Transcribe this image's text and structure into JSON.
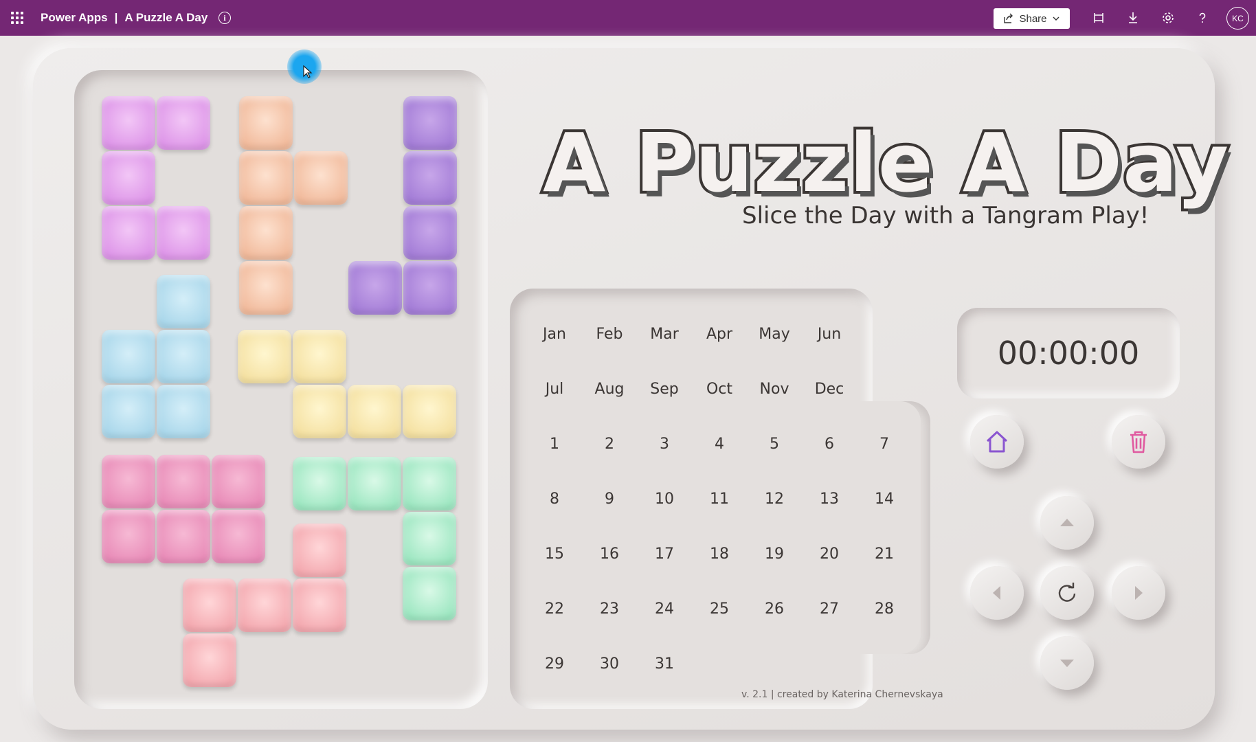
{
  "topbar": {
    "app_name": "Power Apps",
    "separator": "|",
    "app_title": "A Puzzle A Day",
    "share_label": "Share",
    "avatar_initials": "KC",
    "icons": [
      "waffle-icon",
      "info-icon",
      "share-icon",
      "chevron-down-icon",
      "fit-to-window-icon",
      "download-icon",
      "settings-icon",
      "help-icon"
    ],
    "bar_color": "#742774"
  },
  "game": {
    "title": "A Puzzle A Day",
    "subtitle": "Slice the Day with a Tangram Play!",
    "timer": "00:00:00",
    "version_text": "v. 2.1 | created by Katerina Chernevskaya",
    "calendar": {
      "months": [
        "Jan",
        "Feb",
        "Mar",
        "Apr",
        "May",
        "Jun",
        "Jul",
        "Aug",
        "Sep",
        "Oct",
        "Nov",
        "Dec"
      ],
      "days": [
        "1",
        "2",
        "3",
        "4",
        "5",
        "6",
        "7",
        "8",
        "9",
        "10",
        "11",
        "12",
        "13",
        "14",
        "15",
        "16",
        "17",
        "18",
        "19",
        "20",
        "21",
        "22",
        "23",
        "24",
        "25",
        "26",
        "27",
        "28",
        "29",
        "30",
        "31"
      ]
    },
    "controls": [
      "home-icon",
      "trash-icon",
      "arrow-up-icon",
      "arrow-left-icon",
      "rotate-icon",
      "arrow-right-icon",
      "arrow-down-icon"
    ],
    "piece_colors": {
      "magenta": "#dd94e8",
      "peach": "#f1b99a",
      "purple": "#a27bd6",
      "blue": "#a8d6ea",
      "yellow": "#f4e0a0",
      "pink": "#e88ab7",
      "green": "#9be6c0",
      "salmon": "#f3a7ae"
    },
    "control_colors": {
      "home": "#8a55d0",
      "trash": "#e05aa0"
    }
  }
}
